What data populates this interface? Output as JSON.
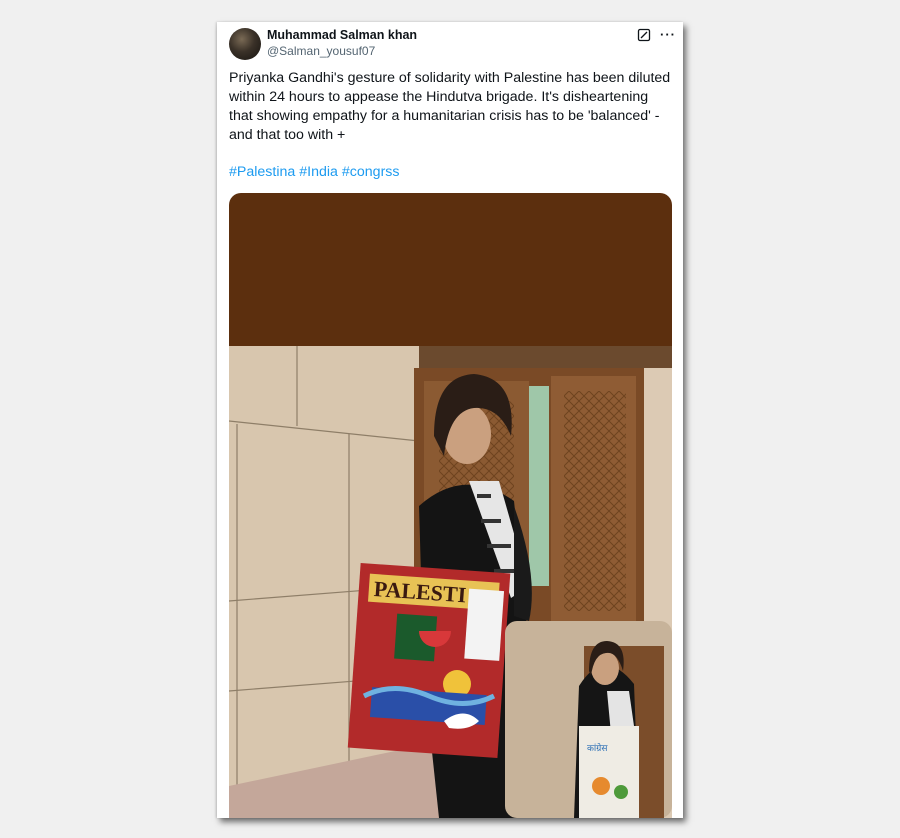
{
  "post": {
    "author_name": "Muhammad Salman khan",
    "author_handle": "@Salman_yousuf07",
    "text": "Priyanka Gandhi's gesture of solidarity with Palestine has been diluted within 24 hours to appease the Hindutva brigade. It's disheartening that showing empathy for a humanitarian crisis has to be 'balanced' - and that too with  +",
    "hashtags": [
      "#Palestina",
      "#India",
      "#congrss"
    ],
    "more_label": "···"
  },
  "media": {
    "bag_text": "PALESTI",
    "small_bag_text": "कांग्रेस"
  },
  "colors": {
    "link": "#1d9bf0",
    "media_top": "#5c2f0e"
  }
}
